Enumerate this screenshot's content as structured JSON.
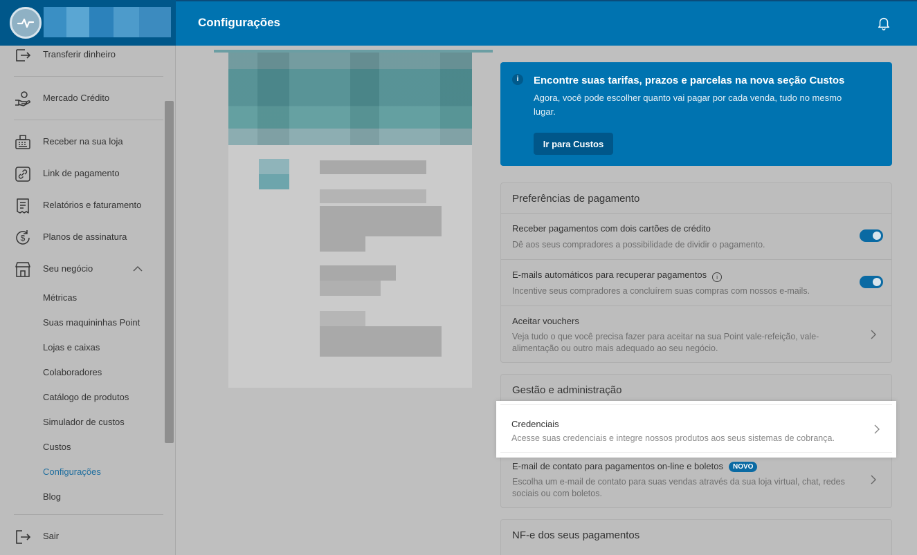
{
  "header": {
    "title": "Configurações"
  },
  "sidebar": {
    "items": [
      {
        "label": "Transferir dinheiro",
        "icon": "transfer-icon"
      },
      {
        "label": "Mercado Crédito",
        "icon": "hand-coin-icon"
      },
      {
        "label": "Receber na sua loja",
        "icon": "cash-register-icon"
      },
      {
        "label": "Link de pagamento",
        "icon": "link-icon"
      },
      {
        "label": "Relatórios e faturamento",
        "icon": "receipt-icon"
      },
      {
        "label": "Planos de assinatura",
        "icon": "dollar-cycle-icon"
      },
      {
        "label": "Seu negócio",
        "icon": "store-icon"
      }
    ],
    "subitems": [
      "Métricas",
      "Suas maquininhas Point",
      "Lojas e caixas",
      "Colaboradores",
      "Catálogo de produtos",
      "Simulador de custos",
      "Custos",
      "Configurações",
      "Blog"
    ],
    "active_subitem": "Configurações",
    "logout": "Sair"
  },
  "banner": {
    "title": "Encontre suas tarifas, prazos e parcelas na nova seção Custos",
    "text": "Agora, você pode escolher quanto vai pagar por cada venda, tudo no mesmo lugar.",
    "button": "Ir para Custos"
  },
  "payment_prefs": {
    "title": "Preferências de pagamento",
    "rows": [
      {
        "title": "Receber pagamentos com dois cartões de crédito",
        "desc": "Dê aos seus compradores a possibilidade de dividir o pagamento.",
        "toggle": true
      },
      {
        "title": "E-mails automáticos para recuperar pagamentos",
        "desc": "Incentive seus compradores a concluírem suas compras com nossos e-mails.",
        "toggle": true
      },
      {
        "title": "Aceitar vouchers",
        "desc": "Veja tudo o que você precisa fazer para aceitar na sua Point vale-refeição, vale-alimentação ou outro mais adequado ao seu negócio."
      }
    ]
  },
  "management": {
    "title": "Gestão e administração",
    "rows": [
      {
        "title": "Credenciais",
        "desc": "Acesse suas credenciais e integre nossos produtos aos seus sistemas de cobrança."
      },
      {
        "title": "E-mail de contato para pagamentos on-line e boletos",
        "badge": "NOVO",
        "desc": "Escolha um e-mail de contato para suas vendas através da sua loja virtual, chat, redes sociais ou com boletos."
      }
    ]
  },
  "nfe": {
    "title": "NF-e dos seus pagamentos"
  }
}
